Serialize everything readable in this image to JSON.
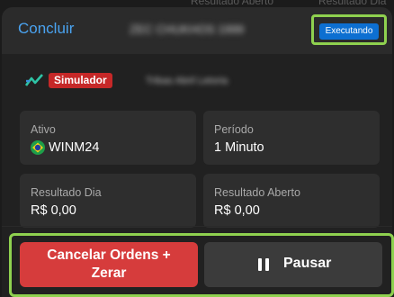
{
  "background_hint": {
    "left": "Resultado Aberto",
    "right": "Resultado Dia"
  },
  "header": {
    "done_label": "Concluir",
    "robot_name": "ZEC CHUKHOS 1999",
    "status_badge": "Executando"
  },
  "simulator": {
    "badge": "Simulador",
    "account_name": "Tribas Abril Letoria"
  },
  "cards": {
    "asset": {
      "label": "Ativo",
      "value": "WINM24",
      "flag_icon": "brazil-flag-icon"
    },
    "period": {
      "label": "Período",
      "value": "1 Minuto"
    },
    "day_result": {
      "label": "Resultado Dia",
      "value": "R$ 0,00"
    },
    "open_result": {
      "label": "Resultado Aberto",
      "value": "R$ 0,00"
    }
  },
  "actions": {
    "cancel_line1": "Cancelar Ordens +",
    "cancel_line2": "Zerar",
    "pause_label": "Pausar"
  },
  "colors": {
    "accent_link": "#4aa3f0",
    "status_blue": "#0d6fd1",
    "simulator_red": "#c62828",
    "cancel_red": "#d63c3c",
    "highlight_green": "#8fd14f"
  }
}
